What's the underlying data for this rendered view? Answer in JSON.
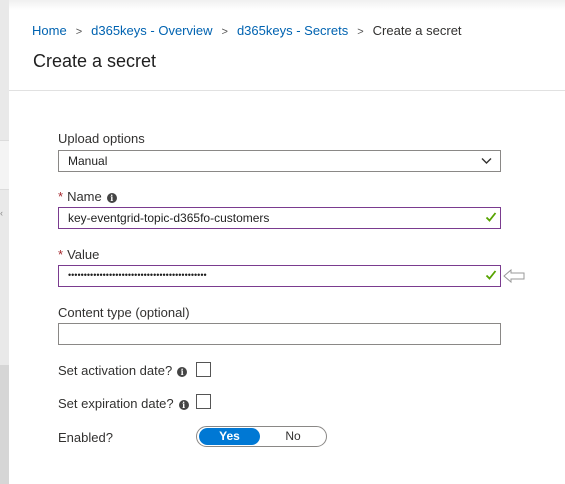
{
  "breadcrumb": {
    "items": [
      "Home",
      "d365keys - Overview",
      "d365keys - Secrets"
    ],
    "current": "Create a secret",
    "separator": ">"
  },
  "page": {
    "title": "Create a secret"
  },
  "form": {
    "upload_options": {
      "label": "Upload options",
      "value": "Manual"
    },
    "name": {
      "label": "Name",
      "required_marker": "*",
      "value": "key-eventgrid-topic-d365fo-customers",
      "valid": true
    },
    "value": {
      "label": "Value",
      "required_marker": "*",
      "masked_value": "••••••••••••••••••••••••••••••••••••••••••••",
      "valid": true
    },
    "content_type": {
      "label": "Content type (optional)",
      "value": ""
    },
    "activation_date": {
      "label": "Set activation date?",
      "checked": false
    },
    "expiration_date": {
      "label": "Set expiration date?",
      "checked": false
    },
    "enabled": {
      "label": "Enabled?",
      "options": [
        "Yes",
        "No"
      ],
      "selected": "Yes"
    }
  },
  "icons": {
    "info": "info-icon",
    "check": "checkmark-icon",
    "chevron": "chevron-down-icon",
    "pointer": "arrow-left-icon"
  },
  "colors": {
    "link": "#0063b1",
    "accent": "#0078d4",
    "valid_border": "#7a3b8f",
    "check": "#57a300",
    "required": "#a4262c"
  }
}
